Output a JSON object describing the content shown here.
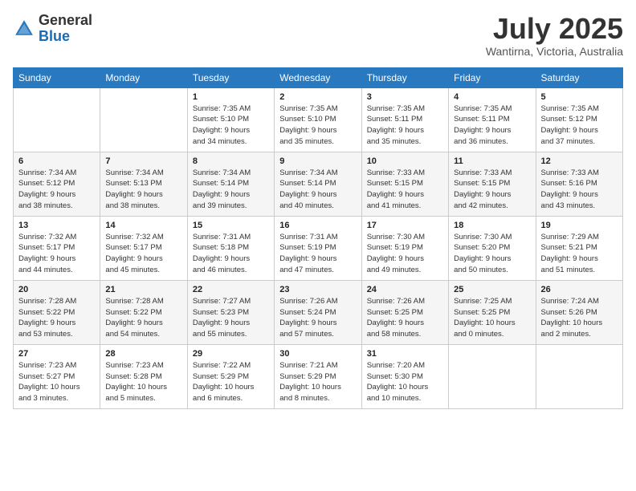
{
  "header": {
    "logo_general": "General",
    "logo_blue": "Blue",
    "month_year": "July 2025",
    "location": "Wantirna, Victoria, Australia"
  },
  "days_of_week": [
    "Sunday",
    "Monday",
    "Tuesday",
    "Wednesday",
    "Thursday",
    "Friday",
    "Saturday"
  ],
  "weeks": [
    [
      {
        "day": "",
        "info": ""
      },
      {
        "day": "",
        "info": ""
      },
      {
        "day": "1",
        "info": "Sunrise: 7:35 AM\nSunset: 5:10 PM\nDaylight: 9 hours\nand 34 minutes."
      },
      {
        "day": "2",
        "info": "Sunrise: 7:35 AM\nSunset: 5:10 PM\nDaylight: 9 hours\nand 35 minutes."
      },
      {
        "day": "3",
        "info": "Sunrise: 7:35 AM\nSunset: 5:11 PM\nDaylight: 9 hours\nand 35 minutes."
      },
      {
        "day": "4",
        "info": "Sunrise: 7:35 AM\nSunset: 5:11 PM\nDaylight: 9 hours\nand 36 minutes."
      },
      {
        "day": "5",
        "info": "Sunrise: 7:35 AM\nSunset: 5:12 PM\nDaylight: 9 hours\nand 37 minutes."
      }
    ],
    [
      {
        "day": "6",
        "info": "Sunrise: 7:34 AM\nSunset: 5:12 PM\nDaylight: 9 hours\nand 38 minutes."
      },
      {
        "day": "7",
        "info": "Sunrise: 7:34 AM\nSunset: 5:13 PM\nDaylight: 9 hours\nand 38 minutes."
      },
      {
        "day": "8",
        "info": "Sunrise: 7:34 AM\nSunset: 5:14 PM\nDaylight: 9 hours\nand 39 minutes."
      },
      {
        "day": "9",
        "info": "Sunrise: 7:34 AM\nSunset: 5:14 PM\nDaylight: 9 hours\nand 40 minutes."
      },
      {
        "day": "10",
        "info": "Sunrise: 7:33 AM\nSunset: 5:15 PM\nDaylight: 9 hours\nand 41 minutes."
      },
      {
        "day": "11",
        "info": "Sunrise: 7:33 AM\nSunset: 5:15 PM\nDaylight: 9 hours\nand 42 minutes."
      },
      {
        "day": "12",
        "info": "Sunrise: 7:33 AM\nSunset: 5:16 PM\nDaylight: 9 hours\nand 43 minutes."
      }
    ],
    [
      {
        "day": "13",
        "info": "Sunrise: 7:32 AM\nSunset: 5:17 PM\nDaylight: 9 hours\nand 44 minutes."
      },
      {
        "day": "14",
        "info": "Sunrise: 7:32 AM\nSunset: 5:17 PM\nDaylight: 9 hours\nand 45 minutes."
      },
      {
        "day": "15",
        "info": "Sunrise: 7:31 AM\nSunset: 5:18 PM\nDaylight: 9 hours\nand 46 minutes."
      },
      {
        "day": "16",
        "info": "Sunrise: 7:31 AM\nSunset: 5:19 PM\nDaylight: 9 hours\nand 47 minutes."
      },
      {
        "day": "17",
        "info": "Sunrise: 7:30 AM\nSunset: 5:19 PM\nDaylight: 9 hours\nand 49 minutes."
      },
      {
        "day": "18",
        "info": "Sunrise: 7:30 AM\nSunset: 5:20 PM\nDaylight: 9 hours\nand 50 minutes."
      },
      {
        "day": "19",
        "info": "Sunrise: 7:29 AM\nSunset: 5:21 PM\nDaylight: 9 hours\nand 51 minutes."
      }
    ],
    [
      {
        "day": "20",
        "info": "Sunrise: 7:28 AM\nSunset: 5:22 PM\nDaylight: 9 hours\nand 53 minutes."
      },
      {
        "day": "21",
        "info": "Sunrise: 7:28 AM\nSunset: 5:22 PM\nDaylight: 9 hours\nand 54 minutes."
      },
      {
        "day": "22",
        "info": "Sunrise: 7:27 AM\nSunset: 5:23 PM\nDaylight: 9 hours\nand 55 minutes."
      },
      {
        "day": "23",
        "info": "Sunrise: 7:26 AM\nSunset: 5:24 PM\nDaylight: 9 hours\nand 57 minutes."
      },
      {
        "day": "24",
        "info": "Sunrise: 7:26 AM\nSunset: 5:25 PM\nDaylight: 9 hours\nand 58 minutes."
      },
      {
        "day": "25",
        "info": "Sunrise: 7:25 AM\nSunset: 5:25 PM\nDaylight: 10 hours\nand 0 minutes."
      },
      {
        "day": "26",
        "info": "Sunrise: 7:24 AM\nSunset: 5:26 PM\nDaylight: 10 hours\nand 2 minutes."
      }
    ],
    [
      {
        "day": "27",
        "info": "Sunrise: 7:23 AM\nSunset: 5:27 PM\nDaylight: 10 hours\nand 3 minutes."
      },
      {
        "day": "28",
        "info": "Sunrise: 7:23 AM\nSunset: 5:28 PM\nDaylight: 10 hours\nand 5 minutes."
      },
      {
        "day": "29",
        "info": "Sunrise: 7:22 AM\nSunset: 5:29 PM\nDaylight: 10 hours\nand 6 minutes."
      },
      {
        "day": "30",
        "info": "Sunrise: 7:21 AM\nSunset: 5:29 PM\nDaylight: 10 hours\nand 8 minutes."
      },
      {
        "day": "31",
        "info": "Sunrise: 7:20 AM\nSunset: 5:30 PM\nDaylight: 10 hours\nand 10 minutes."
      },
      {
        "day": "",
        "info": ""
      },
      {
        "day": "",
        "info": ""
      }
    ]
  ]
}
